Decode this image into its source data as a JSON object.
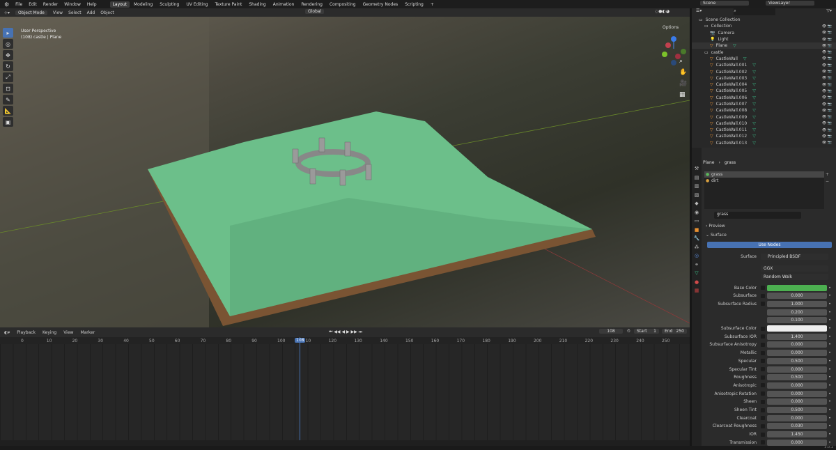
{
  "menu": [
    "File",
    "Edit",
    "Render",
    "Window",
    "Help"
  ],
  "workspaces": [
    "Layout",
    "Modeling",
    "Sculpting",
    "UV Editing",
    "Texture Paint",
    "Shading",
    "Animation",
    "Rendering",
    "Compositing",
    "Geometry Nodes",
    "Scripting",
    "+"
  ],
  "viewport_header": {
    "mode": "Object Mode",
    "menus": [
      "View",
      "Select",
      "Add",
      "Object"
    ],
    "orientation": "Global",
    "options": "Options"
  },
  "viewport": {
    "view_name": "User Perspective",
    "context": "(108) castle | Plane"
  },
  "scene": {
    "scene": "Scene",
    "view_layer": "ViewLayer"
  },
  "outliner": {
    "items": [
      {
        "label": "Scene Collection",
        "depth": 0,
        "type": "collection"
      },
      {
        "label": "Collection",
        "depth": 1,
        "type": "collection"
      },
      {
        "label": "Camera",
        "depth": 2,
        "type": "camera"
      },
      {
        "label": "Light",
        "depth": 2,
        "type": "light"
      },
      {
        "label": "Plane",
        "depth": 2,
        "type": "mesh"
      },
      {
        "label": "castle",
        "depth": 1,
        "type": "collection"
      },
      {
        "label": "CastleWall",
        "depth": 2,
        "type": "mesh"
      },
      {
        "label": "CastleWall.001",
        "depth": 2,
        "type": "mesh"
      },
      {
        "label": "CastleWall.002",
        "depth": 2,
        "type": "mesh"
      },
      {
        "label": "CastleWall.003",
        "depth": 2,
        "type": "mesh"
      },
      {
        "label": "CastleWall.004",
        "depth": 2,
        "type": "mesh"
      },
      {
        "label": "CastleWall.005",
        "depth": 2,
        "type": "mesh"
      },
      {
        "label": "CastleWall.006",
        "depth": 2,
        "type": "mesh"
      },
      {
        "label": "CastleWall.007",
        "depth": 2,
        "type": "mesh"
      },
      {
        "label": "CastleWall.008",
        "depth": 2,
        "type": "mesh"
      },
      {
        "label": "CastleWall.009",
        "depth": 2,
        "type": "mesh"
      },
      {
        "label": "CastleWall.010",
        "depth": 2,
        "type": "mesh"
      },
      {
        "label": "CastleWall.011",
        "depth": 2,
        "type": "mesh"
      },
      {
        "label": "CastleWall.012",
        "depth": 2,
        "type": "mesh"
      },
      {
        "label": "CastleWall.013",
        "depth": 2,
        "type": "mesh"
      }
    ]
  },
  "properties": {
    "breadcrumb": {
      "object": "Plane",
      "material": "grass"
    },
    "slots": [
      "grass",
      "dirt"
    ],
    "material_name": "grass",
    "panels": {
      "preview": "Preview",
      "surface": "Surface"
    },
    "use_nodes": "Use Nodes",
    "surface_label": "Surface",
    "surface_value": "Principled BSDF",
    "distribution": "GGX",
    "subsurface_method": "Random Walk",
    "base_color": "#4caf50",
    "subsurface_color": "#eeeeee",
    "rows": [
      {
        "label": "Base Color",
        "color": "#4caf50"
      },
      {
        "label": "Subsurface",
        "value": "0.000",
        "fill": 0
      },
      {
        "label": "Subsurface Radius",
        "value": "1.000",
        "fill": 0
      },
      {
        "label": "",
        "value": "0.200",
        "fill": 0
      },
      {
        "label": "",
        "value": "0.100",
        "fill": 0
      },
      {
        "label": "Subsurface Color",
        "color": "#eeeeee"
      },
      {
        "label": "Subsurface IOR",
        "value": "1.400",
        "fill": 0.12
      },
      {
        "label": "Subsurface Anisotropy",
        "value": "0.000",
        "fill": 0
      },
      {
        "label": "Metallic",
        "value": "0.000",
        "fill": 0
      },
      {
        "label": "Specular",
        "value": "0.500",
        "fill": 0.5
      },
      {
        "label": "Specular Tint",
        "value": "0.000",
        "fill": 0
      },
      {
        "label": "Roughness",
        "value": "0.500",
        "fill": 0.5
      },
      {
        "label": "Anisotropic",
        "value": "0.000",
        "fill": 0
      },
      {
        "label": "Anisotropic Rotation",
        "value": "0.000",
        "fill": 0
      },
      {
        "label": "Sheen",
        "value": "0.000",
        "fill": 0
      },
      {
        "label": "Sheen Tint",
        "value": "0.500",
        "fill": 0.5
      },
      {
        "label": "Clearcoat",
        "value": "0.000",
        "fill": 0
      },
      {
        "label": "Clearcoat Roughness",
        "value": "0.030",
        "fill": 0.03
      },
      {
        "label": "IOR",
        "value": "1.450",
        "fill": 0
      },
      {
        "label": "Transmission",
        "value": "0.000",
        "fill": 0
      }
    ]
  },
  "timeline": {
    "menus": [
      "Playback",
      "Keying",
      "View",
      "Marker"
    ],
    "current_frame": "108",
    "start_label": "Start",
    "start": "1",
    "end_label": "End",
    "end": "250",
    "ticks": [
      "0",
      "10",
      "20",
      "30",
      "40",
      "50",
      "60",
      "70",
      "80",
      "90",
      "100",
      "110",
      "120",
      "130",
      "140",
      "150",
      "160",
      "170",
      "180",
      "190",
      "200",
      "210",
      "220",
      "230",
      "240",
      "250"
    ]
  },
  "status": {
    "version": "3.0.1"
  }
}
